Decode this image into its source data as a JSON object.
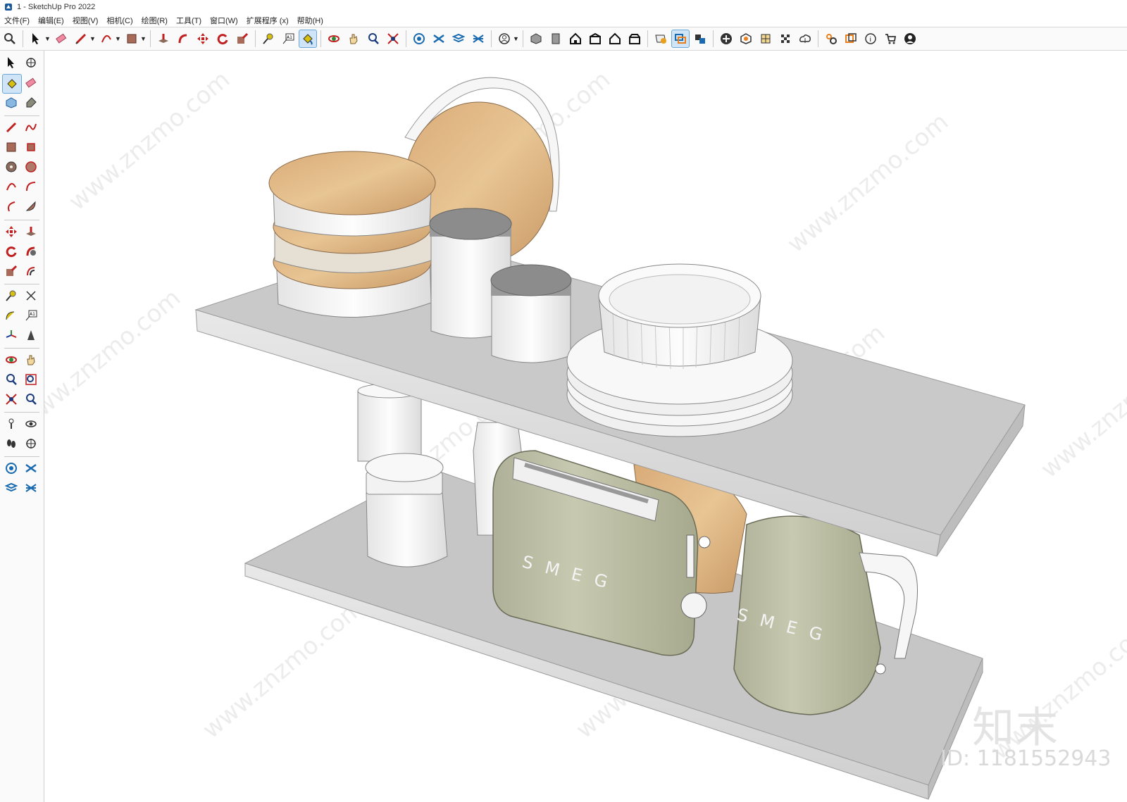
{
  "window": {
    "title": "1 - SketchUp Pro 2022"
  },
  "menu": [
    "文件(F)",
    "编辑(E)",
    "视图(V)",
    "相机(C)",
    "绘图(R)",
    "工具(T)",
    "窗口(W)",
    "扩展程序 (x)",
    "帮助(H)"
  ],
  "toolbar": {
    "icons": [
      "zoom-icon",
      "select-icon",
      "eraser-icon",
      "pencil-icon",
      "arc-icon",
      "rectangle-icon",
      "push-pull-icon",
      "follow-me-icon",
      "move-icon",
      "rotate-icon",
      "scale-icon",
      "tape-measure-icon",
      "text-icon",
      "paint-bucket-icon",
      "orbit-icon",
      "pan-icon",
      "zoom-tool-icon",
      "zoom-extents-icon",
      "warehouse-icon",
      "extension-warehouse-icon",
      "layout-icon",
      "trimble-connect-icon",
      "account-icon",
      "iso-view-icon",
      "top-view-icon",
      "front-view-icon",
      "right-view-icon",
      "back-view-icon",
      "left-view-icon",
      "section-plane-icon",
      "display-section-icon",
      "section-fill-icon",
      "add-location-icon",
      "sandbox-icon",
      "style-icon",
      "xray-icon",
      "upload-icon",
      "settings-icon",
      "instructor-icon",
      "model-info-icon",
      "cart-icon",
      "profile-icon"
    ],
    "active_icon": "display-section-icon"
  },
  "left_toolbar": {
    "active_icon": "paint-bucket-icon"
  },
  "viewport": {
    "model": "shelf-with-kitchen-items",
    "brand_on_toaster": "SMEG",
    "brand_on_kettle": "SMEG",
    "watermark_text": "www.znzmo.com",
    "logo_text": "知末",
    "id_text": "ID: 1181552943"
  },
  "colors": {
    "toolbar_bg": "#fafafa",
    "active_bg": "#cfe4f7",
    "shelf": "#c9c9c9",
    "appliance": "#b9bca0",
    "wood": "#e0b98a",
    "white_item": "#f4f4f4",
    "lid_gray": "#8c8c8c"
  }
}
